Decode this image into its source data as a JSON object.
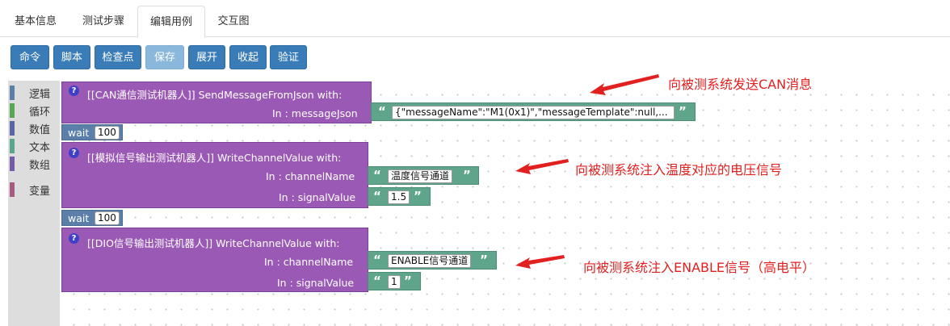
{
  "tabs": [
    "基本信息",
    "测试步骤",
    "编辑用例",
    "交互图"
  ],
  "active_tab": "编辑用例",
  "toolbar": {
    "buttons": [
      "命令",
      "脚本",
      "检查点",
      "保存",
      "展开",
      "收起",
      "验证"
    ]
  },
  "toolbox": {
    "categories": [
      {
        "label": "逻辑",
        "color": "#5b80a5"
      },
      {
        "label": "循环",
        "color": "#5ba55b"
      },
      {
        "label": "数值",
        "color": "#5b67a5"
      },
      {
        "label": "文本",
        "color": "#5ba58c"
      },
      {
        "label": "数组",
        "color": "#745ba5"
      },
      {
        "label": "变量",
        "color": "#a55b80"
      }
    ]
  },
  "blocks": {
    "b1": {
      "help": "?",
      "header": "[[CAN通信测试机器人]]  SendMessageFromJson  with:",
      "param1_label": "In : messageJson",
      "param1_value": "{\"messageName\":\"M1(0x1)\",\"messageTemplate\":null,..."
    },
    "wait1": {
      "label": "wait",
      "value": "100"
    },
    "b2": {
      "help": "?",
      "header": "[[模拟信号输出测试机器人]]  WriteChannelValue  with:",
      "param1_label": "In : channelName",
      "param1_value": "温度信号通道",
      "param2_label": "In : signalValue",
      "param2_value": "1.5"
    },
    "wait2": {
      "label": "wait",
      "value": "100"
    },
    "b3": {
      "help": "?",
      "header": "[[DIO信号输出测试机器人]]  WriteChannelValue  with:",
      "param1_label": "In : channelName",
      "param1_value": "ENABLE信号通道",
      "param2_label": "In : signalValue",
      "param2_value": "1"
    },
    "quote_open": "“",
    "quote_close": "”"
  },
  "annotations": {
    "a1": "向被测系统发送CAN消息",
    "a2": "向被测系统注入温度对应的电压信号",
    "a3": "向被测系统注入ENABLE信号（高电平）",
    "color": "#e32020"
  }
}
